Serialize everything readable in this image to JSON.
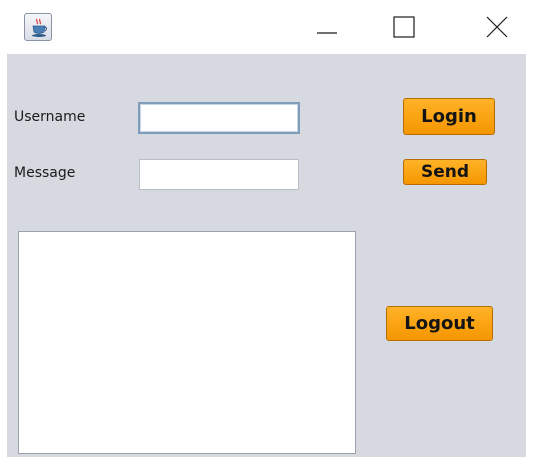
{
  "window": {
    "title": "",
    "app_icon": "java-cup-icon",
    "controls": {
      "minimize_icon": "minimize-icon",
      "maximize_icon": "maximize-icon",
      "close_icon": "close-icon"
    }
  },
  "form": {
    "username_label": "Username",
    "username_value": "",
    "message_label": "Message",
    "message_value": "",
    "login_label": "Login",
    "send_label": "Send",
    "logout_label": "Logout",
    "chat_log": ""
  },
  "colors": {
    "client_background": "#d6d9e0",
    "button_accent": "#f59600",
    "field_focus_border": "#7f9db9"
  }
}
